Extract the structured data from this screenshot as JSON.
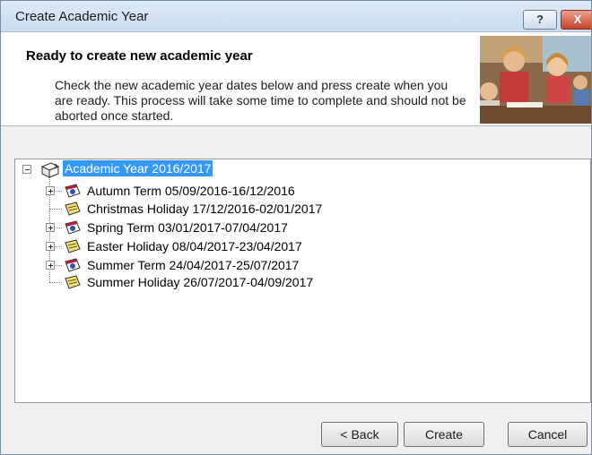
{
  "window": {
    "title": "Create Academic Year",
    "help_label": "?",
    "close_label": "X"
  },
  "header": {
    "title": "Ready to create new academic year",
    "description": "Check the new academic year dates below and press create when you are ready. This process will take some time to complete and should not be aborted once started."
  },
  "tree": {
    "root": "Academic Year 2016/2017",
    "items": [
      {
        "label": "Autumn Term 05/09/2016-16/12/2016",
        "type": "term",
        "expandable": true
      },
      {
        "label": "Christmas Holiday 17/12/2016-02/01/2017",
        "type": "holiday",
        "expandable": false
      },
      {
        "label": "Spring Term 03/01/2017-07/04/2017",
        "type": "term",
        "expandable": true
      },
      {
        "label": "Easter Holiday 08/04/2017-23/04/2017",
        "type": "holiday",
        "expandable": true
      },
      {
        "label": "Summer Term 24/04/2017-25/07/2017",
        "type": "term",
        "expandable": true
      },
      {
        "label": "Summer Holiday 26/07/2017-04/09/2017",
        "type": "holiday",
        "expandable": false
      }
    ]
  },
  "buttons": {
    "back": "< Back",
    "create": "Create",
    "cancel": "Cancel"
  },
  "colors": {
    "selection": "#3399ff",
    "titlebar": "#c9dcf0",
    "close": "#c6422a"
  }
}
